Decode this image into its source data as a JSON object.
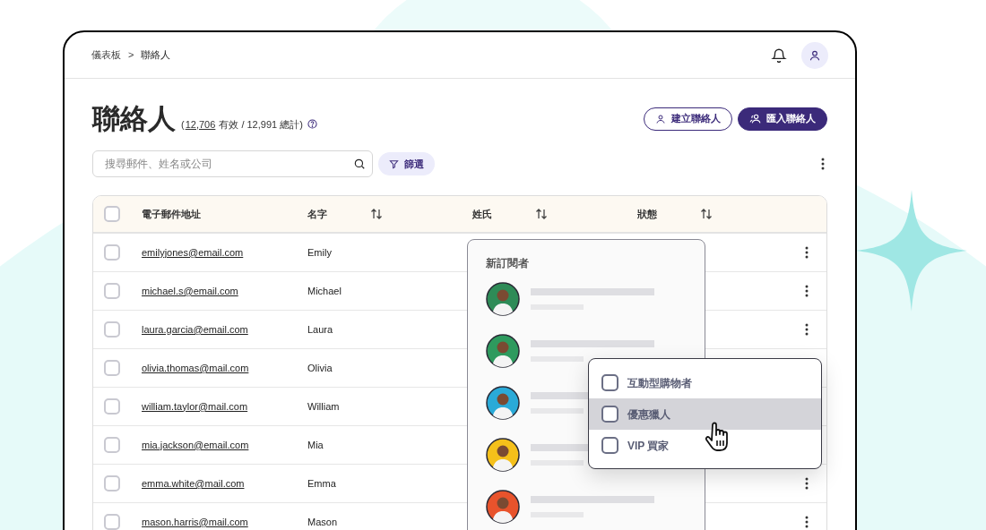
{
  "breadcrumb": {
    "items": [
      "儀表板",
      "聯絡人"
    ],
    "separator": ">"
  },
  "page": {
    "title": "聯絡人",
    "open_paren": "(",
    "active_count": "12,706",
    "summary_rest": "有效 / 12,991 總計)"
  },
  "actions": [
    {
      "label": "建立聯絡人",
      "kind": "outline"
    },
    {
      "label": "匯入聯絡人",
      "kind": "primary"
    }
  ],
  "search": {
    "placeholder": "搜尋郵件、姓名或公司"
  },
  "filter_button": {
    "label": "篩選"
  },
  "table": {
    "select_all_checked": false,
    "columns": [
      {
        "label": "電子郵件地址",
        "sortable": false
      },
      {
        "label": "名字",
        "sortable": true
      },
      {
        "label": "姓氏",
        "sortable": true
      },
      {
        "label": "狀態",
        "sortable": true
      }
    ],
    "rows": [
      {
        "email": "emilyjones@email.com",
        "first_name": "Emily",
        "checked": false
      },
      {
        "email": "michael.s@email.com",
        "first_name": "Michael",
        "checked": false
      },
      {
        "email": "laura.garcia@email.com",
        "first_name": "Laura",
        "checked": false
      },
      {
        "email": "olivia.thomas@mail.com",
        "first_name": "Olivia",
        "checked": false
      },
      {
        "email": "william.taylor@mail.com",
        "first_name": "William",
        "checked": false
      },
      {
        "email": "mia.jackson@email.com",
        "first_name": "Mia",
        "checked": false
      },
      {
        "email": "emma.white@mail.com",
        "first_name": "Emma",
        "checked": false
      },
      {
        "email": "mason.harris@mail.com",
        "first_name": "Mason",
        "checked": false
      }
    ]
  },
  "subscribers_popover": {
    "title": "新訂閱者",
    "entries": [
      {
        "color": "#2e8b57"
      },
      {
        "color": "#2e9a5e"
      },
      {
        "color": "#2aaad8"
      },
      {
        "color": "#f5c01a"
      },
      {
        "color": "#e8532c"
      }
    ]
  },
  "tag_dropdown": {
    "options": [
      {
        "label": "互動型購物者",
        "checked": false,
        "selected": false
      },
      {
        "label": "優惠獵人",
        "checked": false,
        "selected": true
      },
      {
        "label": "VIP 買家",
        "checked": false,
        "selected": false
      }
    ]
  }
}
